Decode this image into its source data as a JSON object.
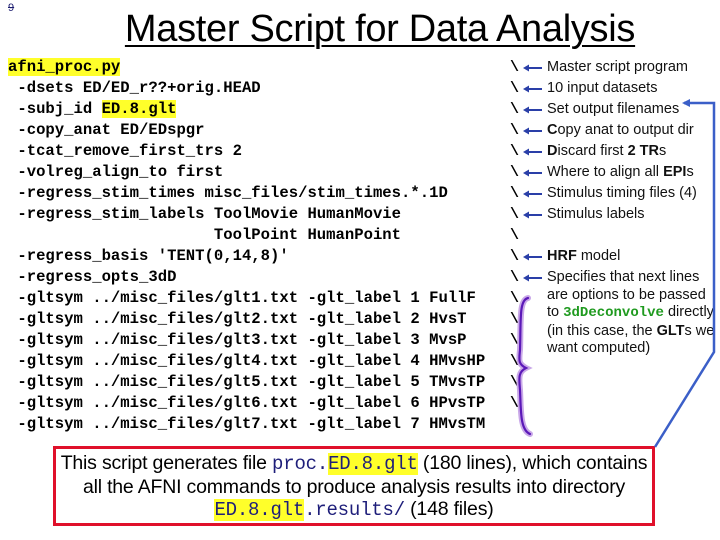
{
  "slide": {
    "page_number": "9",
    "title": "Master Script for Data Analysis"
  },
  "script": {
    "lines": [
      {
        "parts": [
          {
            "text": "afni_proc.py",
            "hl": true
          }
        ]
      },
      {
        "parts": [
          {
            "text": " -dsets ED/ED_r??+orig.HEAD"
          }
        ]
      },
      {
        "parts": [
          {
            "text": " -subj_id "
          },
          {
            "text": "ED.8.glt",
            "hl": true
          }
        ]
      },
      {
        "parts": [
          {
            "text": " -copy_anat ED/EDspgr"
          }
        ]
      },
      {
        "parts": [
          {
            "text": " -tcat_remove_first_trs 2"
          }
        ]
      },
      {
        "parts": [
          {
            "text": " -volreg_align_to first"
          }
        ]
      },
      {
        "parts": [
          {
            "text": " -regress_stim_times misc_files/stim_times.*.1D"
          }
        ]
      },
      {
        "parts": [
          {
            "text": " -regress_stim_labels ToolMovie HumanMovie"
          }
        ]
      },
      {
        "parts": [
          {
            "text": "                      ToolPoint HumanPoint"
          }
        ]
      },
      {
        "parts": [
          {
            "text": " -regress_basis 'TENT(0,14,8)'"
          }
        ]
      },
      {
        "parts": [
          {
            "text": " -regress_opts_3dD"
          }
        ]
      },
      {
        "parts": [
          {
            "text": " -gltsym ../misc_files/glt1.txt -glt_label 1 FullF"
          }
        ]
      },
      {
        "parts": [
          {
            "text": " -gltsym ../misc_files/glt2.txt -glt_label 2 HvsT"
          }
        ]
      },
      {
        "parts": [
          {
            "text": " -gltsym ../misc_files/glt3.txt -glt_label 3 MvsP"
          }
        ]
      },
      {
        "parts": [
          {
            "text": " -gltsym ../misc_files/glt4.txt -glt_label 4 HMvsHP"
          }
        ]
      },
      {
        "parts": [
          {
            "text": " -gltsym ../misc_files/glt5.txt -glt_label 5 TMvsTP"
          }
        ]
      },
      {
        "parts": [
          {
            "text": " -gltsym ../misc_files/glt6.txt -glt_label 6 HPvsTP"
          }
        ]
      },
      {
        "parts": [
          {
            "text": " -gltsym ../misc_files/glt7.txt -glt_label 7 HMvsTM"
          }
        ]
      }
    ],
    "continuation_char": "\\",
    "continuation_line_count": 17
  },
  "annotations": {
    "notes": [
      {
        "text": "Master script program"
      },
      {
        "text": "10 input datasets"
      },
      {
        "text": "Set output filenames"
      },
      {
        "bold_prefix": "C",
        "text": "opy anat to output dir"
      },
      {
        "bold_prefix": "D",
        "text": "iscard first ",
        "bold_mid": "2 TR",
        "tail": "s"
      },
      {
        "text": "Where to align all ",
        "bold_mid": "EPI",
        "tail": "s"
      },
      {
        "text": "Stimulus timing files (4)"
      },
      {
        "text": "Stimulus labels"
      },
      {
        "text": ""
      },
      {
        "bold_prefix": "HRF",
        "text": " model"
      }
    ],
    "options_note": {
      "before": "Specifies that next lines are options to be passed to",
      "program": "3dDeconvolve",
      "after_1": "directly (in this case, the ",
      "after_bold": "GLT",
      "after_2": "s we want computed)"
    }
  },
  "summary_box": {
    "pre": "This script generates file ",
    "file_prefix": "proc.",
    "file_hl": "ED.8.glt",
    "mid": " (180 lines), which contains all the AFNI commands to produce analysis results into directory ",
    "dir_hl": "ED.8.glt",
    "dir_suffix": ".results/",
    "post": " (148 files)"
  },
  "colors": {
    "highlight": "#ffff2a",
    "box_border": "#e0102a",
    "connector": "#3b5fc8",
    "brace": "#5b18b8",
    "program_green": "#1f9a1f"
  }
}
